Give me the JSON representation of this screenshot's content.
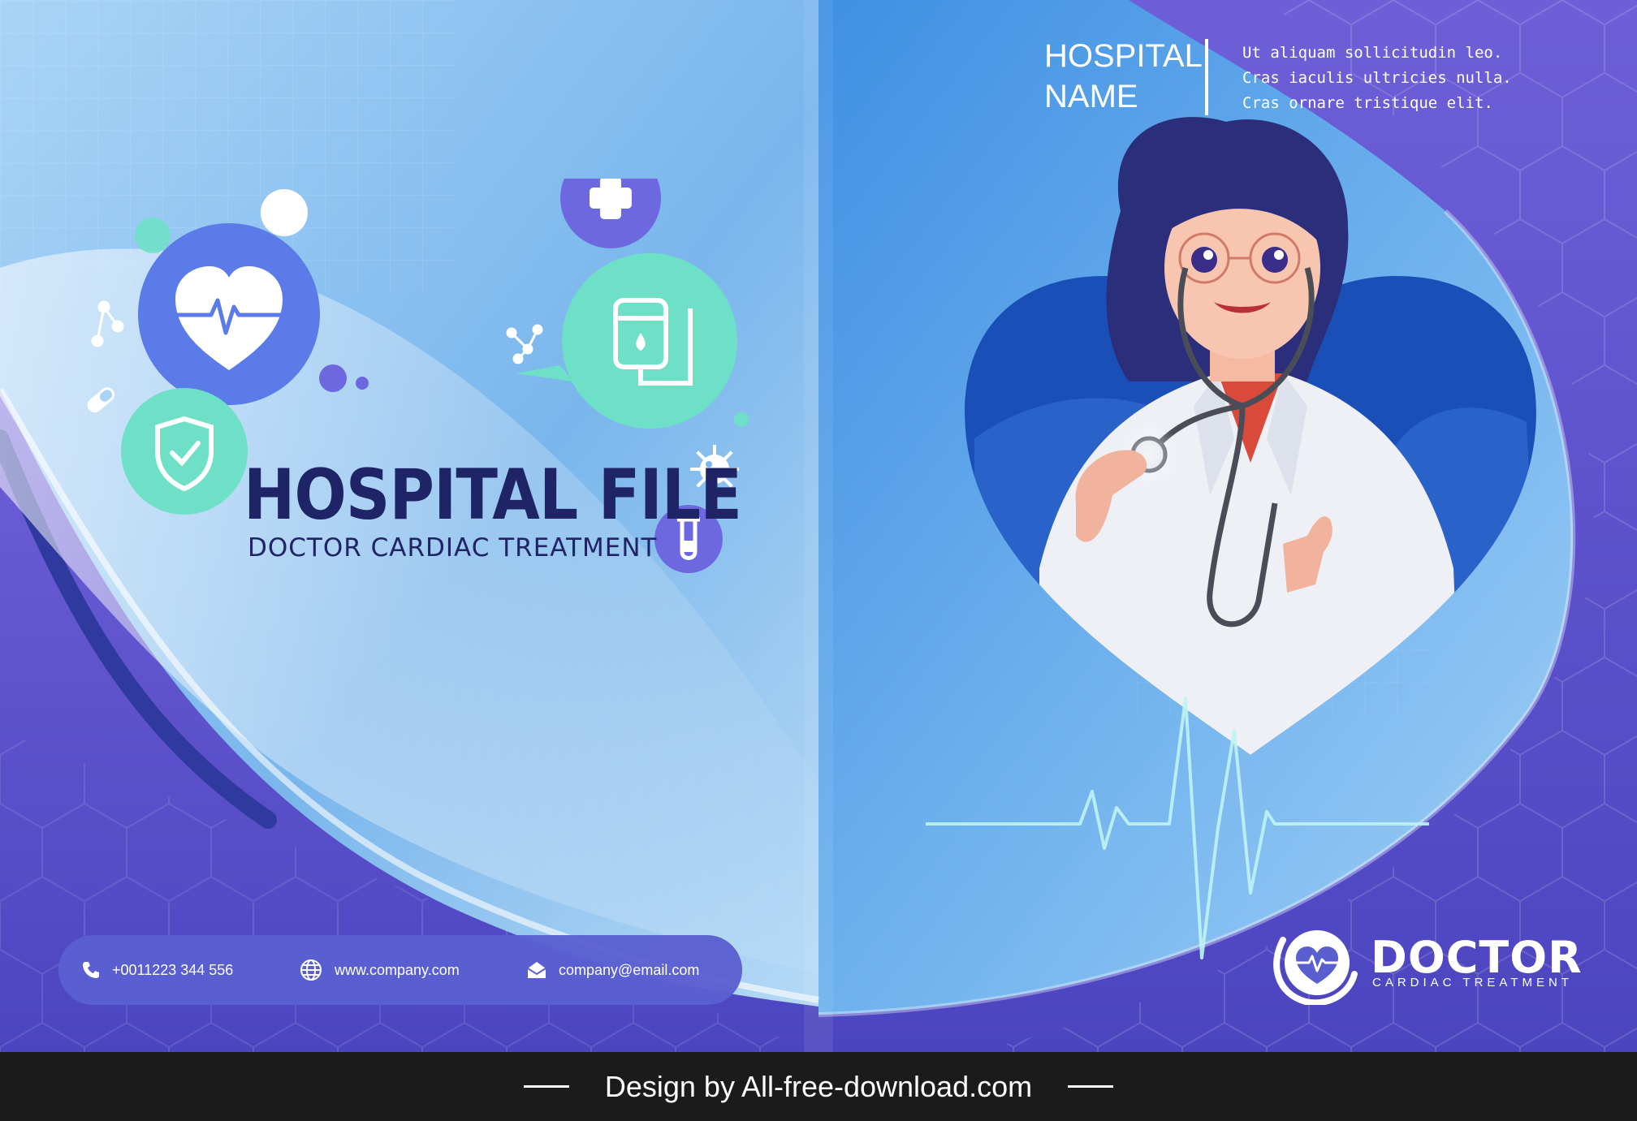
{
  "cover": {
    "title": "HOSPITAL FILE",
    "subtitle": "DOCTOR CARDIAC TREATMENT",
    "hospital_name_line1": "HOSPITAL",
    "hospital_name_line2": "NAME",
    "blurb": [
      "Ut aliquam sollicitudin leo.",
      "Cras iaculis ultricies nulla.",
      "Cras ornare tristique elit."
    ]
  },
  "contact": {
    "phone": "+0011223 344 556",
    "website": "www.company.com",
    "email": "company@email.com"
  },
  "logo": {
    "word": "DOCTOR",
    "tagline": "CARDIAC TREATMENT"
  },
  "icons": [
    "heart-pulse-icon",
    "shield-check-icon",
    "medical-cross-icon",
    "iv-bag-icon",
    "test-tube-icon",
    "virus-icon",
    "molecule-icon",
    "pill-icon",
    "phone-icon",
    "globe-icon",
    "envelope-icon"
  ],
  "colors": {
    "navy_text": "#1f2466",
    "blue_primary": "#5a5fd0",
    "sky": "#7ab8ee",
    "mint": "#6fe0c8"
  },
  "footer": {
    "credit": "Design by All-free-download.com"
  }
}
